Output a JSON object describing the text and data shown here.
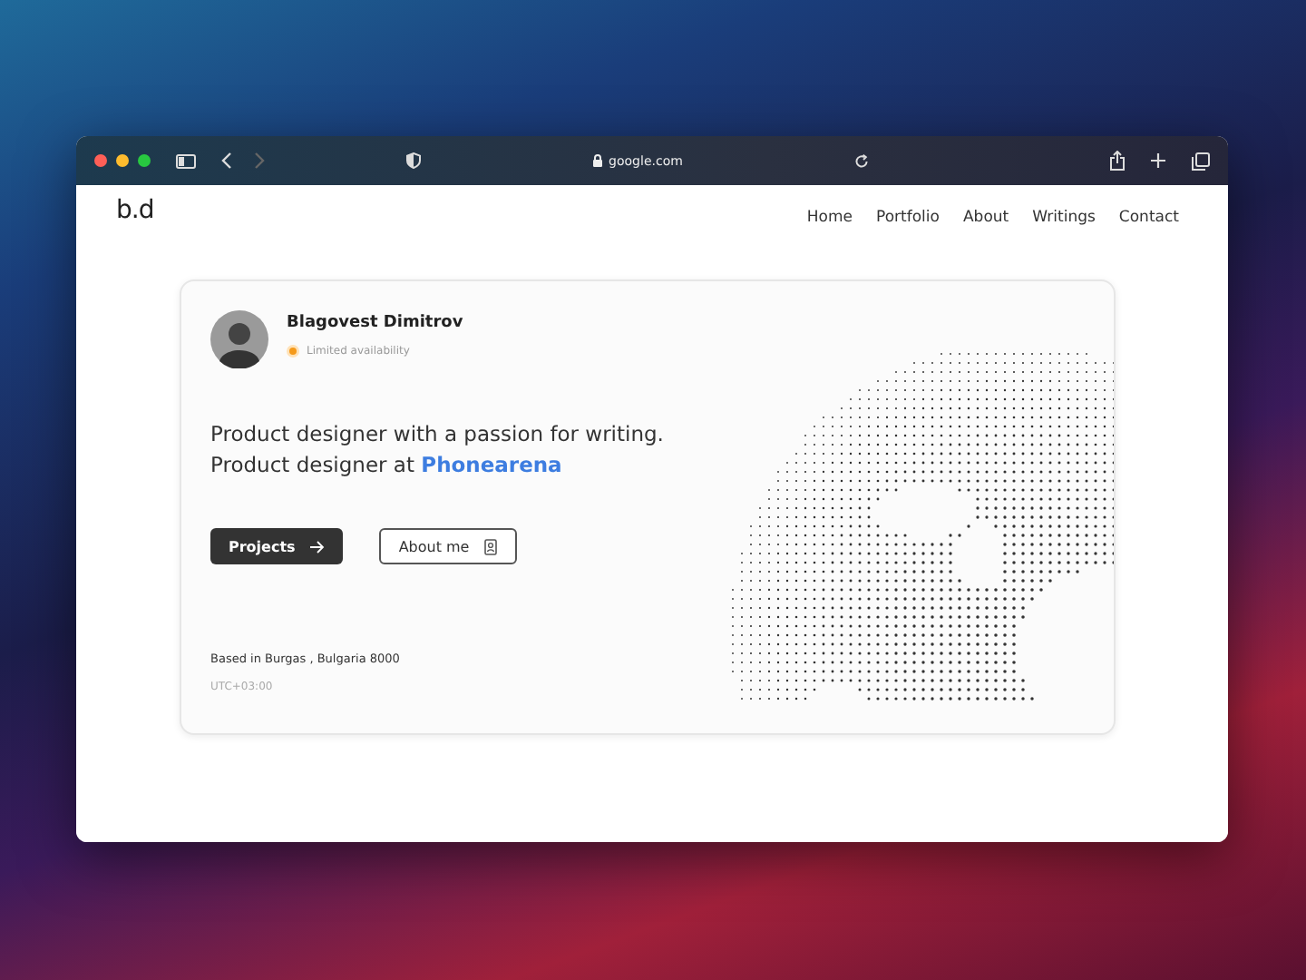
{
  "browser": {
    "url": "google.com"
  },
  "site": {
    "logo": "b.d",
    "nav": [
      {
        "label": "Home"
      },
      {
        "label": "Portfolio"
      },
      {
        "label": "About"
      },
      {
        "label": "Writings"
      },
      {
        "label": "Contact"
      }
    ]
  },
  "profile": {
    "name": "Blagovest Dimitrov",
    "status": "Limited availability",
    "headline": "Product designer with a passion for writing.",
    "role_prefix": "Product designer at",
    "role_company": "Phonearena",
    "buttons": [
      {
        "label": "Projects",
        "kind": "primary"
      },
      {
        "label": "About me",
        "kind": "secondary"
      }
    ],
    "location": "Based in Burgas , Bulgaria 8000",
    "timezone": "UTC+03:00"
  }
}
